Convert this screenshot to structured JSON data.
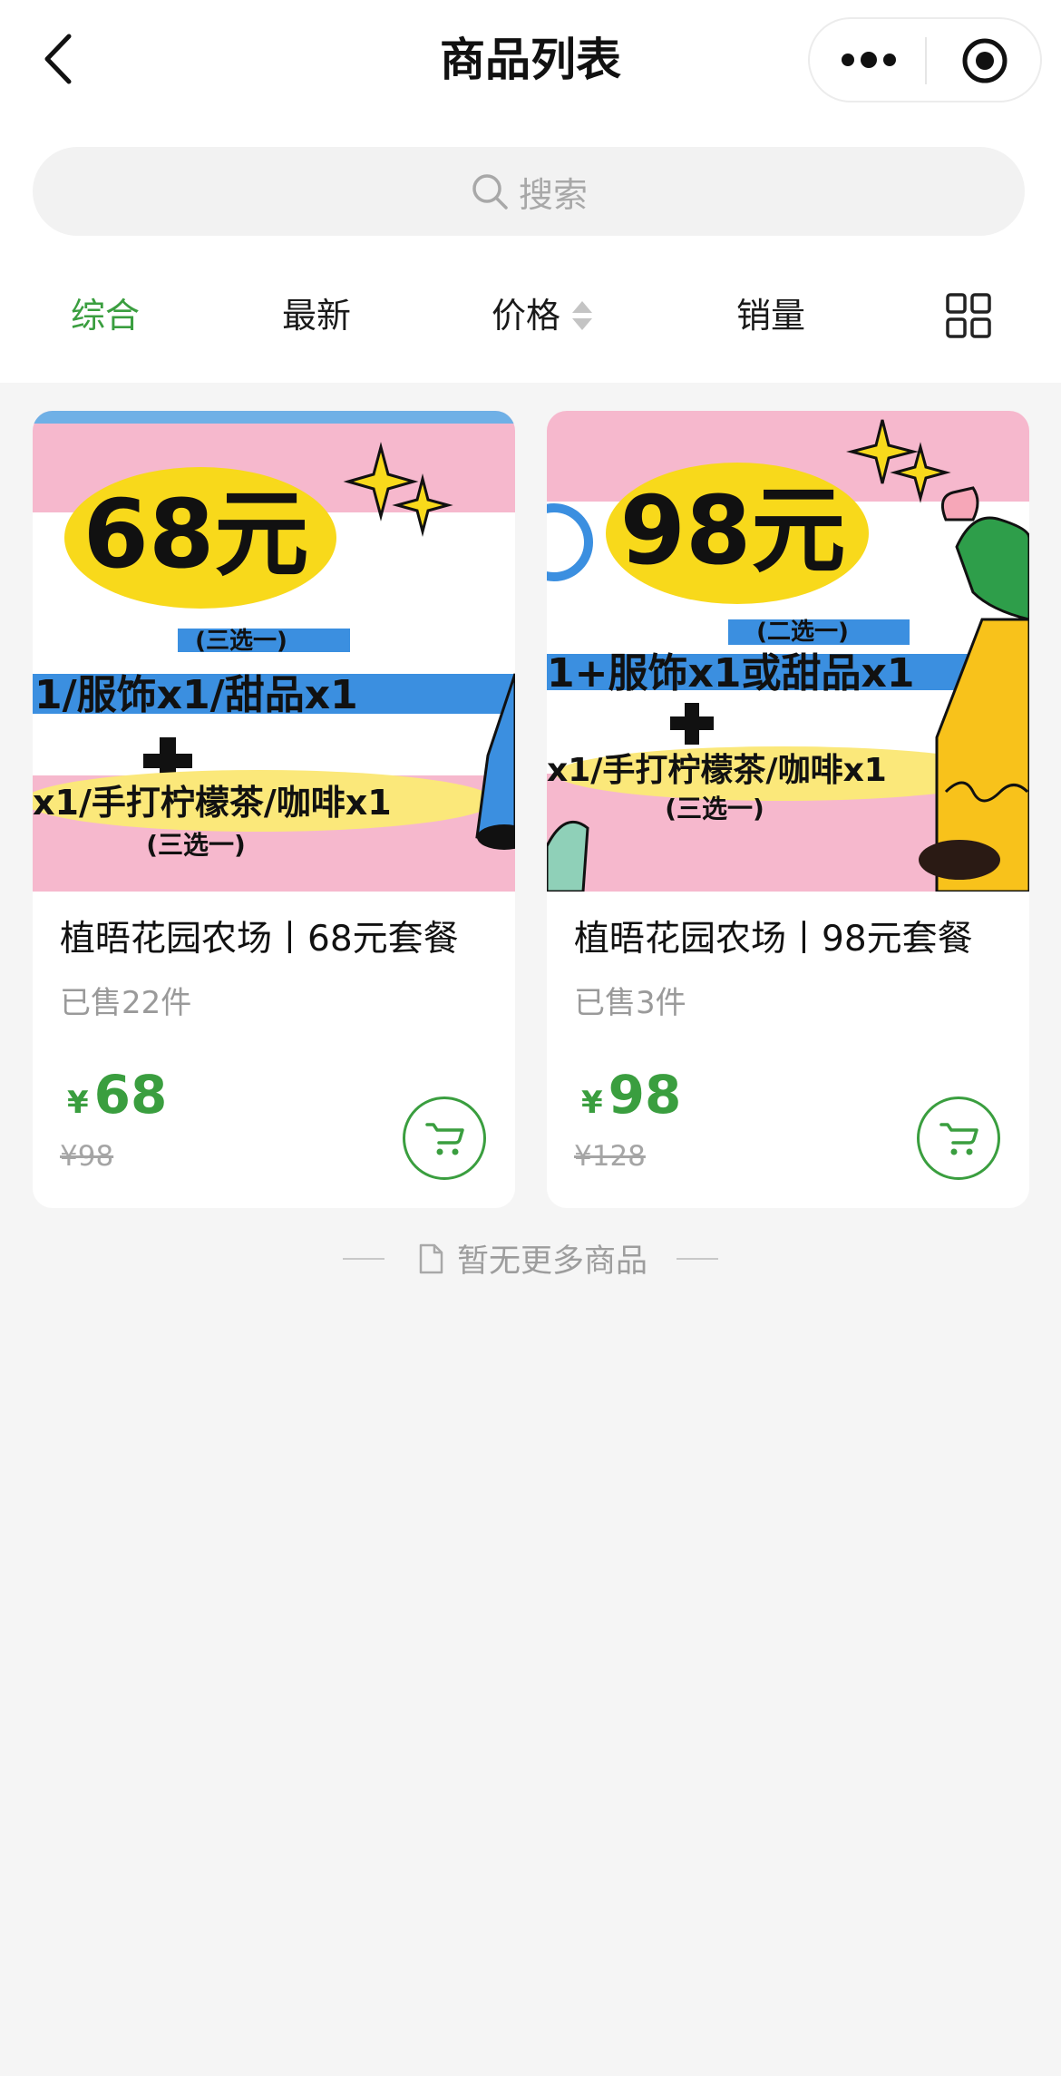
{
  "nav": {
    "title": "商品列表"
  },
  "search": {
    "placeholder": "搜索"
  },
  "filters": [
    {
      "label": "综合",
      "active": true
    },
    {
      "label": "最新",
      "active": false
    },
    {
      "label": "价格",
      "active": false
    },
    {
      "label": "销量",
      "active": false
    }
  ],
  "products": [
    {
      "name": "植晤花园农场丨68元套餐",
      "sold": "已售22件",
      "currency": "¥",
      "price": "68",
      "original_price": "¥98",
      "banner": {
        "headline": "68元",
        "choice_top": "(三选一)",
        "line1": "1/服饰x1/甜品x1",
        "line2": "x1/手打柠檬茶/咖啡x1",
        "choice_bottom": "(三选一)"
      }
    },
    {
      "name": "植晤花园农场丨98元套餐",
      "sold": "已售3件",
      "currency": "¥",
      "price": "98",
      "original_price": "¥128",
      "banner": {
        "headline": "98元",
        "choice_top": "(二选一)",
        "line1": "1+服饰x1或甜品x1",
        "line2": "x1/手打柠檬茶/咖啡x1",
        "choice_bottom": "(三选一)"
      }
    }
  ],
  "footer": {
    "end_text": "暂无更多商品"
  },
  "colors": {
    "accent": "#3a9e3f",
    "background": "#f5f5f5",
    "banner_pink": "#f6b8cd",
    "banner_yellow": "#f8d91b",
    "banner_blue": "#3b8fe0"
  }
}
